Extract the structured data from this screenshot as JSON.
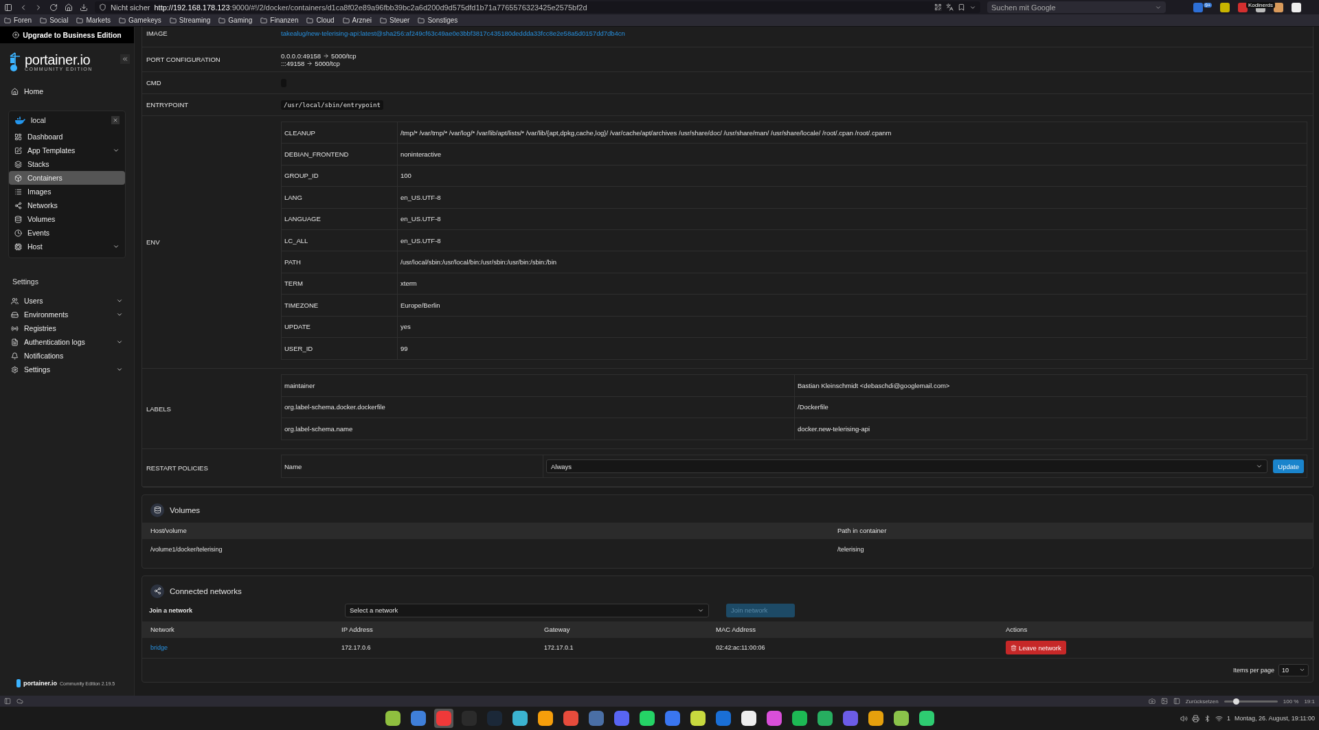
{
  "browser": {
    "security": "Nicht sicher",
    "url_host": "http://192.168.178.123",
    "url_rest": ":9000/#!/2/docker/containers/d1ca8f02e89a96fbb39bc2a6d200d9d575dfd1b71a7765576323425e2575bf2d",
    "search_placeholder": "Suchen mit Google",
    "extension_badge": "9+",
    "tooltip": "Kodinerds"
  },
  "bookmarks": [
    "Foren",
    "Social",
    "Markets",
    "Gamekeys",
    "Streaming",
    "Gaming",
    "Finanzen",
    "Cloud",
    "Arznei",
    "Steuer",
    "Sonstiges"
  ],
  "sidebar": {
    "upgrade": "Upgrade to Business Edition",
    "logo": "portainer.io",
    "logo_sub": "COMMUNITY EDITION",
    "home": "Home",
    "environment": "local",
    "env_items": [
      {
        "label": "Dashboard",
        "selected": false,
        "expandable": false
      },
      {
        "label": "App Templates",
        "selected": false,
        "expandable": true
      },
      {
        "label": "Stacks",
        "selected": false,
        "expandable": false
      },
      {
        "label": "Containers",
        "selected": true,
        "expandable": false
      },
      {
        "label": "Images",
        "selected": false,
        "expandable": false
      },
      {
        "label": "Networks",
        "selected": false,
        "expandable": false
      },
      {
        "label": "Volumes",
        "selected": false,
        "expandable": false
      },
      {
        "label": "Events",
        "selected": false,
        "expandable": false
      },
      {
        "label": "Host",
        "selected": false,
        "expandable": true
      }
    ],
    "settings_title": "Settings",
    "settings_items": [
      {
        "label": "Users",
        "expandable": true
      },
      {
        "label": "Environments",
        "expandable": true
      },
      {
        "label": "Registries",
        "expandable": false
      },
      {
        "label": "Authentication logs",
        "expandable": true
      },
      {
        "label": "Notifications",
        "expandable": false
      },
      {
        "label": "Settings",
        "expandable": true
      }
    ],
    "footer_brand": "portainer.io",
    "footer_text": "Community Edition 2.19.5"
  },
  "details": [
    {
      "kind": "link",
      "label": "IMAGE",
      "value": "takealug/new-telerising-api:latest@sha256:af249cf63c49ae0e3bbf3817c435180deddda33fcc8e2e58a5d0157dd7db4cn"
    },
    {
      "kind": "ports",
      "label": "PORT CONFIGURATION",
      "ports": [
        {
          "from": "0.0.0.0:49158",
          "to": "5000/tcp"
        },
        {
          "from": ":::49158",
          "to": "5000/tcp"
        }
      ]
    },
    {
      "kind": "empty-code",
      "label": "CMD"
    },
    {
      "kind": "code",
      "label": "ENTRYPOINT",
      "value": "/usr/local/sbin/entrypoint"
    },
    {
      "kind": "env",
      "label": "ENV",
      "pairs": [
        {
          "key": "CLEANUP",
          "value": "/tmp/* /var/tmp/* /var/log/* /var/lib/apt/lists/* /var/lib/{apt,dpkg,cache,log}/ /var/cache/apt/archives /usr/share/doc/ /usr/share/man/ /usr/share/locale/ /root/.cpan /root/.cpanm"
        },
        {
          "key": "DEBIAN_FRONTEND",
          "value": "noninteractive"
        },
        {
          "key": "GROUP_ID",
          "value": "100"
        },
        {
          "key": "LANG",
          "value": "en_US.UTF-8"
        },
        {
          "key": "LANGUAGE",
          "value": "en_US.UTF-8"
        },
        {
          "key": "LC_ALL",
          "value": "en_US.UTF-8"
        },
        {
          "key": "PATH",
          "value": "/usr/local/sbin:/usr/local/bin:/usr/sbin:/usr/bin:/sbin:/bin"
        },
        {
          "key": "TERM",
          "value": "xterm"
        },
        {
          "key": "TIMEZONE",
          "value": "Europe/Berlin"
        },
        {
          "key": "UPDATE",
          "value": "yes"
        },
        {
          "key": "USER_ID",
          "value": "99"
        }
      ]
    },
    {
      "kind": "labels",
      "label": "LABELS",
      "pairs": [
        {
          "key": "maintainer",
          "value": "Bastian Kleinschmidt <debaschdi@googlemail.com>"
        },
        {
          "key": "org.label-schema.docker.dockerfile",
          "value": "/Dockerfile"
        },
        {
          "key": "org.label-schema.name",
          "value": "docker.new-telerising-api"
        }
      ]
    },
    {
      "kind": "restart",
      "label": "RESTART POLICIES",
      "name_label": "Name",
      "value": "Always",
      "button": "Update"
    }
  ],
  "volumes": {
    "title": "Volumes",
    "columns": [
      "Host/volume",
      "Path in container"
    ],
    "rows": [
      [
        "/volume1/docker/telerising",
        "/telerising"
      ]
    ]
  },
  "networks": {
    "title": "Connected networks",
    "join_label": "Join a network",
    "select_placeholder": "Select a network",
    "join_button": "Join network",
    "join_disabled": true,
    "columns": [
      "Network",
      "IP Address",
      "Gateway",
      "MAC Address",
      "Actions"
    ],
    "rows": [
      {
        "network": "bridge",
        "ip": "172.17.0.6",
        "gateway": "172.17.0.1",
        "mac": "02:42:ac:11:00:06",
        "action": "Leave network"
      }
    ],
    "items_per_page_label": "Items per page",
    "items_per_page": "10"
  },
  "statusbar": {
    "reset": "Zurücksetzen",
    "zoom": "100 %",
    "zoom_slider": {
      "level": 0.22
    },
    "time": "19:1"
  },
  "taskbar": {
    "apps": [
      {
        "color": "#8fbf3f",
        "selected": false
      },
      {
        "color": "#3f7fd8",
        "selected": false
      },
      {
        "color": "#ef3939",
        "selected": true
      },
      {
        "color": "#2b2b2b",
        "selected": false
      },
      {
        "color": "#1b2838",
        "selected": false
      },
      {
        "color": "#3bb3d0",
        "selected": false
      },
      {
        "color": "#f59e0b",
        "selected": false
      },
      {
        "color": "#e74c3c",
        "selected": false
      },
      {
        "color": "#4a6fa5",
        "selected": false
      },
      {
        "color": "#5865f2",
        "selected": false
      },
      {
        "color": "#25d366",
        "selected": false
      },
      {
        "color": "#3a76f0",
        "selected": false
      },
      {
        "color": "#c8d93f",
        "selected": false
      },
      {
        "color": "#1a6fd6",
        "selected": false
      },
      {
        "color": "#eeeeee",
        "selected": false
      },
      {
        "color": "#d94fd9",
        "selected": false
      },
      {
        "color": "#1db954",
        "selected": false
      },
      {
        "color": "#27ae60",
        "selected": false
      },
      {
        "color": "#6c5ce7",
        "selected": false
      },
      {
        "color": "#e5a00d",
        "selected": false
      },
      {
        "color": "#8bc34a",
        "selected": false
      },
      {
        "color": "#2ecc71",
        "selected": false
      }
    ],
    "clock": "Montag, 26. August, 19:11:00",
    "tray_badge": "1"
  }
}
